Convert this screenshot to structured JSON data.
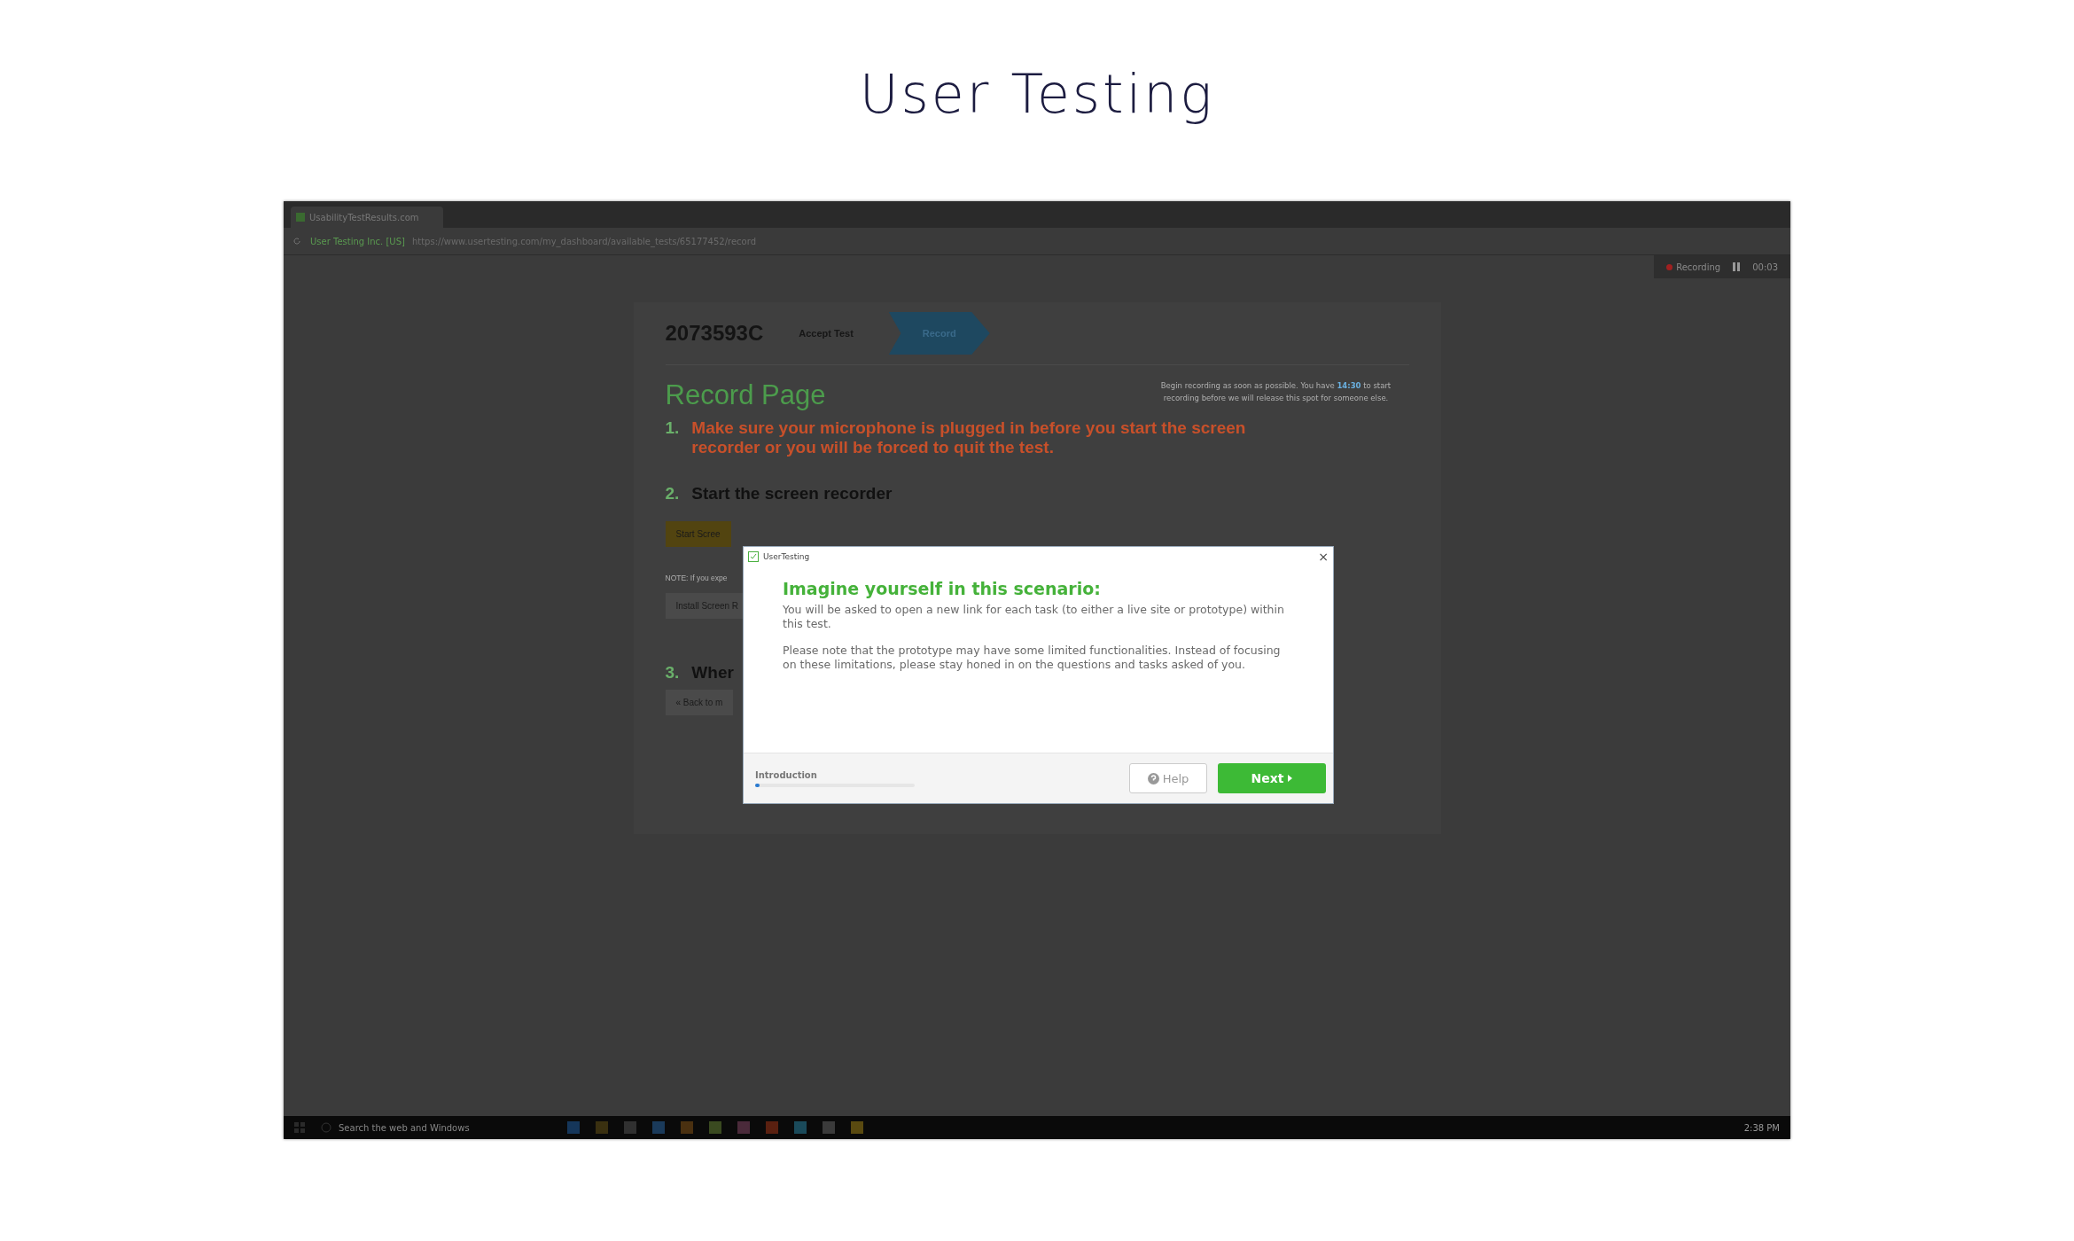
{
  "page_title": "User Testing",
  "browser": {
    "tab_title": "UsabilityTestResults.com",
    "site_badge": "User Testing Inc. [US]",
    "url": "https://www.usertesting.com/my_dashboard/available_tests/65177452/record"
  },
  "recorder": {
    "label": "Recording",
    "time": "00:03"
  },
  "card": {
    "test_id": "2073593C",
    "steps": [
      {
        "label": "Accept Test",
        "selected": false
      },
      {
        "label": "Record",
        "selected": true
      }
    ],
    "heading": "Record Page",
    "notice": "Begin recording as soon as possible. You have **14:30** to start recording before we will release this spot for someone else.",
    "items": [
      {
        "number": "1.",
        "text": "Make sure your microphone is plugged in before you start the screen recorder or you will be forced to quit the test.",
        "kind": "warning"
      },
      {
        "number": "2.",
        "text": "Start the screen recorder",
        "kind": "step"
      },
      {
        "number": "3.",
        "text": "Wher",
        "kind": "step"
      }
    ],
    "start_button": "Start Scree",
    "note": "NOTE: If you expe",
    "install_button": "Install Screen R",
    "back_button": "« Back to m"
  },
  "dialog": {
    "app_name": "UserTesting",
    "close": "×",
    "heading": "Imagine yourself in this scenario:",
    "paragraphs": [
      "You will be asked to open a new link for each task (to either a live site or prototype) within this test.",
      "Please note that the prototype may have some limited functionalities. Instead of focusing on these limitations, please stay honed in on the questions and tasks asked of you."
    ],
    "progress": {
      "label": "Introduction",
      "level": 0.03
    },
    "help_button": "Help",
    "next_button": "Next"
  },
  "taskbar": {
    "search_placeholder": "Search the web and Windows",
    "clock": "2:38 PM"
  }
}
